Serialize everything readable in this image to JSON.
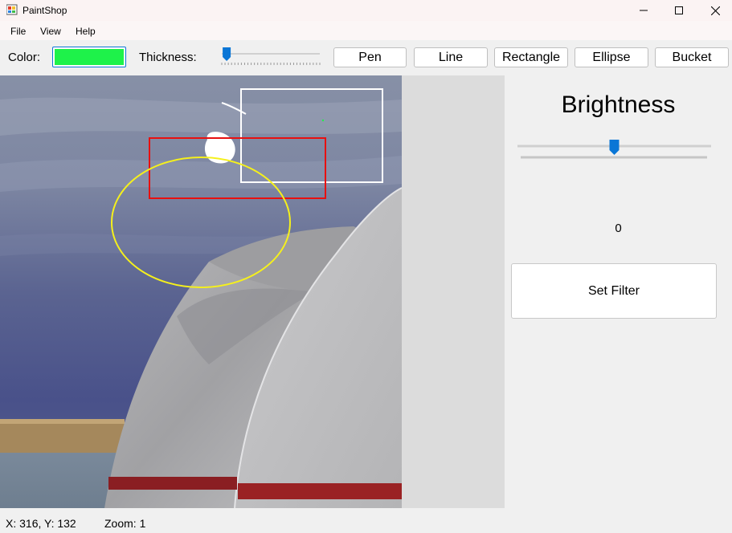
{
  "window": {
    "title": "PaintShop",
    "icon": "paint-palette-icon",
    "controls": [
      "minimize-icon",
      "maximize-icon",
      "close-icon"
    ]
  },
  "menu": {
    "file": "File",
    "view": "View",
    "help": "Help"
  },
  "toolbar": {
    "color_label": "Color:",
    "color_value": "#1ef24a",
    "thickness_label": "Thickness:",
    "thickness_level": 0.05,
    "tools": {
      "pen": "Pen",
      "line": "Line",
      "rectangle": "Rectangle",
      "ellipse": "Ellipse",
      "bucket": "Bucket"
    }
  },
  "canvas": {
    "image": "photo-white-sail-roof-structures-against-cloudy-sky",
    "shapes": {
      "rectangle_colors": [
        "#e81010",
        "#ffffff"
      ],
      "ellipse_color": "#f5f01c"
    }
  },
  "panel": {
    "title": "Brightness",
    "slider_level": 0.5,
    "value": "0",
    "set_filter": "Set Filter"
  },
  "status": {
    "coords": "X: 316, Y: 132",
    "zoom": "Zoom: 1"
  },
  "colors": {
    "accent": "#0a76d6",
    "window_bg": "#f0f0f0",
    "canvas_bg": "#dcdcdc"
  }
}
